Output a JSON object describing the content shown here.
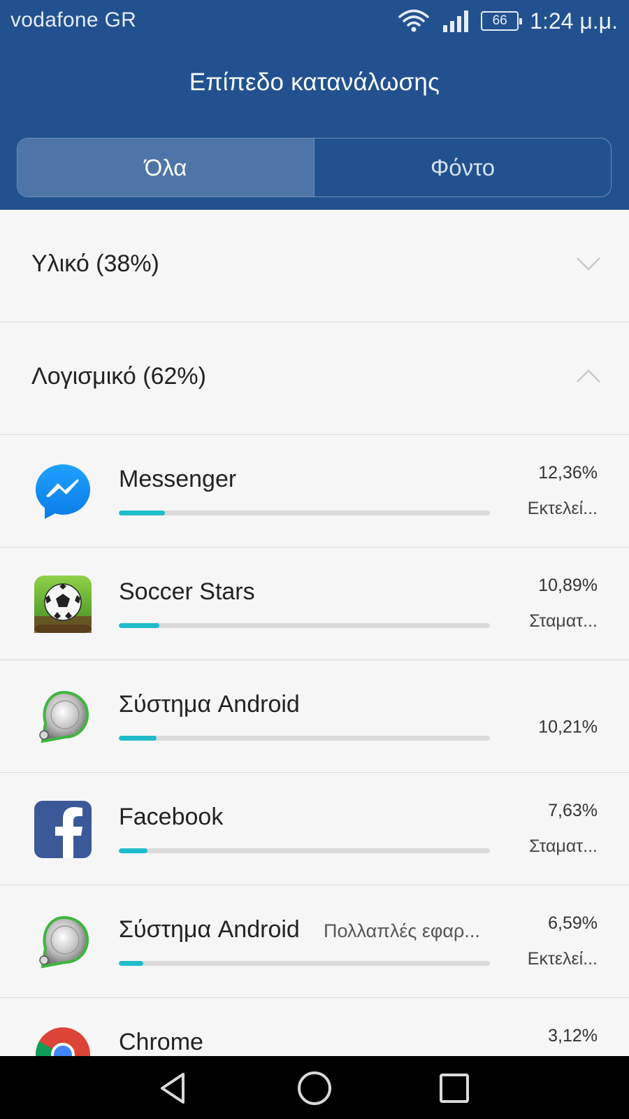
{
  "status_bar": {
    "carrier": "vodafone GR",
    "battery": "66",
    "time": "1:24 μ.μ.",
    "icons": [
      "wifi-icon",
      "signal-icon",
      "battery-icon"
    ]
  },
  "header": {
    "title": "Επίπεδο κατανάλωσης",
    "tabs": [
      {
        "label": "Όλα",
        "selected": true
      },
      {
        "label": "Φόντο",
        "selected": false
      }
    ]
  },
  "sections": [
    {
      "label": "Υλικό (38%)",
      "expanded": false
    },
    {
      "label": "Λογισμικό (62%)",
      "expanded": true
    }
  ],
  "apps": [
    {
      "name": "Messenger",
      "sub": "",
      "percent": "12,36%",
      "state": "Εκτελεί...",
      "usage": 12.36,
      "icon": "messenger-icon"
    },
    {
      "name": "Soccer Stars",
      "sub": "",
      "percent": "10,89%",
      "state": "Σταματ...",
      "usage": 10.89,
      "icon": "soccer-stars-icon"
    },
    {
      "name": "Σύστημα Android",
      "sub": "",
      "percent": "10,21%",
      "state": "",
      "usage": 10.21,
      "icon": "android-system-icon"
    },
    {
      "name": "Facebook",
      "sub": "",
      "percent": "7,63%",
      "state": "Σταματ...",
      "usage": 7.63,
      "icon": "facebook-icon"
    },
    {
      "name": "Σύστημα Android",
      "sub": "Πολλαπλές εφαρ...",
      "percent": "6,59%",
      "state": "Εκτελεί...",
      "usage": 6.59,
      "icon": "android-system-icon"
    },
    {
      "name": "Chrome",
      "sub": "",
      "percent": "3,12%",
      "state": "",
      "usage": 3.12,
      "icon": "chrome-icon"
    }
  ],
  "colors": {
    "header_bg": "#22518f",
    "tab_active_bg": "#4e75a8",
    "bar_fill": "#1fbcc9",
    "bar_track": "#dadada"
  },
  "nav": [
    "back-icon",
    "home-icon",
    "recents-icon"
  ]
}
